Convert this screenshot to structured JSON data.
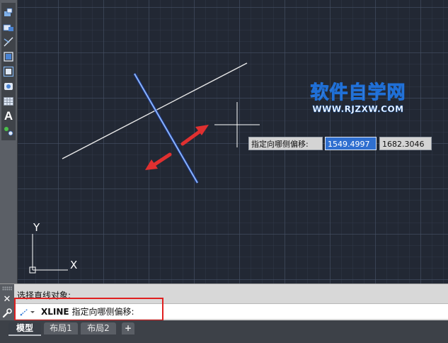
{
  "toolbar": {
    "tools": [
      "arc-drawing-icon",
      "insert-block-icon",
      "trim-icon",
      "rectangle-icon",
      "region-icon",
      "revision-cloud-icon",
      "table-icon",
      "multiline-text-icon",
      "add-selected-icon"
    ],
    "text_tool_label": "A"
  },
  "canvas": {
    "ucs_x_label": "X",
    "ucs_y_label": "Y",
    "colors": {
      "background": "#222834",
      "construction_line": "#e8e8e8",
      "highlighted_line": "#5f9cff",
      "arrows": "#e03030"
    }
  },
  "dynamic_input": {
    "prompt": "指定向哪侧偏移:",
    "x_value": "1549.4997",
    "y_value": "1682.3046"
  },
  "watermark": {
    "title": "软件自学网",
    "url": "WWW.RJZXW.COM"
  },
  "command_line": {
    "history": "选择直线对象:",
    "command_name": "XLINE",
    "command_prompt": "指定向哪侧偏移:",
    "close_icon": "close-icon",
    "customize_icon": "wrench-icon"
  },
  "layout_tabs": {
    "tabs": [
      {
        "label": "模型",
        "active": true
      },
      {
        "label": "布局1",
        "active": false
      },
      {
        "label": "布局2",
        "active": false
      }
    ],
    "add_label": "+"
  }
}
